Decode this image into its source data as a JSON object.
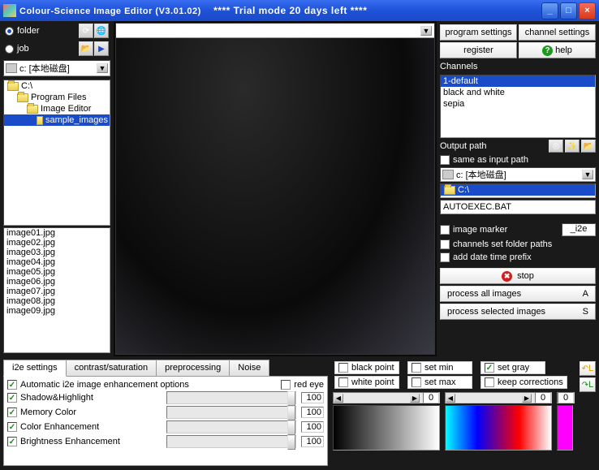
{
  "titlebar": {
    "title": "Colour-Science Image Editor (V3.01.02)",
    "trial": "**** Trial mode 20 days left ****"
  },
  "left": {
    "radio_folder": "folder",
    "radio_job": "job",
    "drive": "c: [本地磁盘]",
    "tree": [
      {
        "label": "C:\\",
        "level": 1
      },
      {
        "label": "Program Files",
        "level": 2
      },
      {
        "label": "Image Editor",
        "level": 3
      },
      {
        "label": "sample_images",
        "level": 4,
        "sel": true
      }
    ],
    "files": [
      "image01.jpg",
      "image02.jpg",
      "image03.jpg",
      "image04.jpg",
      "image05.jpg",
      "image06.jpg",
      "image07.jpg",
      "image08.jpg",
      "image09.jpg"
    ]
  },
  "right": {
    "program_settings": "program settings",
    "channel_settings": "channel settings",
    "register": "register",
    "help": "help",
    "channels_label": "Channels",
    "channels": [
      "1-default",
      "black and white",
      "sepia"
    ],
    "output_label": "Output path",
    "same_as_input": "same as input path",
    "out_drive": "c: [本地磁盘]",
    "out_folder": "C:\\",
    "out_file": "AUTOEXEC.BAT",
    "image_marker": "image marker",
    "marker_val": "_i2e",
    "channels_set": "channels set folder paths",
    "add_date": "add date time prefix",
    "stop": "stop",
    "process_all": "process all images",
    "process_all_key": "A",
    "process_sel": "process selected images",
    "process_sel_key": "S"
  },
  "bottom": {
    "tabs": [
      "i2e settings",
      "contrast/saturation",
      "preprocessing",
      "Noise"
    ],
    "auto_i2e": "Automatic i2e image enhancement options",
    "red_eye": "red eye",
    "opts": [
      {
        "label": "Shadow&Highlight",
        "val": "100"
      },
      {
        "label": "Memory Color",
        "val": "100"
      },
      {
        "label": "Color Enhancement",
        "val": "100"
      },
      {
        "label": "Brightness Enhancement",
        "val": "100"
      }
    ],
    "black_point": "black point",
    "white_point": "white point",
    "set_min": "set min",
    "set_max": "set max",
    "set_gray": "set gray",
    "keep_corr": "keep corrections",
    "slider_vals": [
      "0",
      "0",
      "0"
    ],
    "side_l1": "L",
    "side_l2": "L"
  }
}
